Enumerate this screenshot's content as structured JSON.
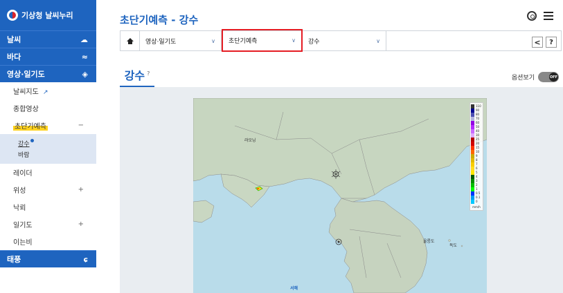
{
  "brand": {
    "title": "기상청 날씨누리"
  },
  "sidebar": {
    "categories": [
      {
        "label": "날씨",
        "icon": "sun-cloud-icon"
      },
      {
        "label": "바다",
        "icon": "wave-icon"
      },
      {
        "label": "영상·일기도",
        "icon": "satellite-icon"
      }
    ],
    "items": [
      {
        "label": "날씨지도",
        "sign": ""
      },
      {
        "label": "종합영상",
        "sign": ""
      },
      {
        "label": "초단기예측",
        "sign": "−"
      },
      {
        "label": "레이더",
        "sign": ""
      },
      {
        "label": "위성",
        "sign": "+"
      },
      {
        "label": "낙뢰",
        "sign": ""
      },
      {
        "label": "일기도",
        "sign": "+"
      },
      {
        "label": "이는비",
        "sign": ""
      }
    ],
    "subitems": [
      "강수",
      "바람"
    ],
    "bottom_category": {
      "label": "태풍",
      "icon": "typhoon-icon"
    }
  },
  "header": {
    "title": "초단기예측 - 강수"
  },
  "breadcrumb": {
    "level1": "영상·일기도",
    "level2": "초단기예측",
    "level3": "강수",
    "share_glyph": "<",
    "help_glyph": "?"
  },
  "tab": {
    "label": "강수",
    "help": "?"
  },
  "options": {
    "label": "옵션보기",
    "toggle": "OFF"
  },
  "legend": {
    "unit": "mm/h",
    "levels": [
      {
        "v": "110",
        "c": "#333333"
      },
      {
        "v": "90",
        "c": "#000390"
      },
      {
        "v": "80",
        "c": "#4c4eb1"
      },
      {
        "v": "70",
        "c": "#b3b4de"
      },
      {
        "v": "60",
        "c": "#9300e4"
      },
      {
        "v": "50",
        "c": "#b329ff"
      },
      {
        "v": "40",
        "c": "#c969ff"
      },
      {
        "v": "30",
        "c": "#e0a9ff"
      },
      {
        "v": "25",
        "c": "#b40000"
      },
      {
        "v": "20",
        "c": "#d20000"
      },
      {
        "v": "15",
        "c": "#ff3200"
      },
      {
        "v": "10",
        "c": "#ff6600"
      },
      {
        "v": "9",
        "c": "#ccaa00"
      },
      {
        "v": "8",
        "c": "#e0b900"
      },
      {
        "v": "7",
        "c": "#f9cd00"
      },
      {
        "v": "6",
        "c": "#ffdc1f"
      },
      {
        "v": "5",
        "c": "#ffe600"
      },
      {
        "v": "4",
        "c": "#005a00"
      },
      {
        "v": "3",
        "c": "#008c00"
      },
      {
        "v": "2",
        "c": "#00be00"
      },
      {
        "v": "1",
        "c": "#00ff00"
      },
      {
        "v": "0.5",
        "c": "#0033ff"
      },
      {
        "v": "0.1",
        "c": "#009bf5"
      },
      {
        "v": "0",
        "c": "#00c8ff"
      }
    ]
  },
  "map_labels": {
    "northeast": "랴오닝",
    "east_sea_island": "울릉도",
    "dokdo": "독도",
    "sea_west": "서해"
  },
  "colors": {
    "accent": "#1e64bf",
    "highlight": "#e51c23",
    "marker": "#ffd21f"
  }
}
